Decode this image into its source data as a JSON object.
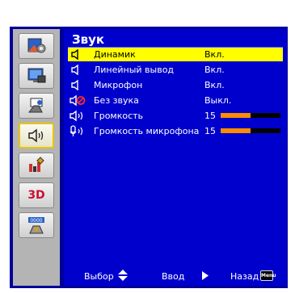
{
  "title": "Звук",
  "sidebar": {
    "items": [
      {
        "icon": "image-settings-icon",
        "active": false
      },
      {
        "icon": "display-settings-icon",
        "active": false
      },
      {
        "icon": "setup-settings-icon",
        "active": false
      },
      {
        "icon": "sound-settings-icon",
        "active": true
      },
      {
        "icon": "options-settings-icon",
        "active": false
      },
      {
        "icon": "3d-settings-icon",
        "label": "3D",
        "active": false
      },
      {
        "icon": "network-settings-icon",
        "label": "0000",
        "active": false
      }
    ]
  },
  "rows": [
    {
      "label": "Динамик",
      "value": "Вкл.",
      "icon": "speaker-icon",
      "selected": true
    },
    {
      "label": "Линейный вывод",
      "value": "Вкл.",
      "icon": "speaker-icon",
      "selected": false
    },
    {
      "label": "Микрофон",
      "value": "Вкл.",
      "icon": "speaker-icon",
      "selected": false
    },
    {
      "label": "Без звука",
      "value": "Выкл.",
      "icon": "mute-icon",
      "selected": false
    },
    {
      "label": "Громкость",
      "value": "15",
      "icon": "volume-icon",
      "level": 0.5,
      "selected": false
    },
    {
      "label": "Громкость микрофона",
      "value": "15",
      "icon": "microphone-icon",
      "level": 0.5,
      "selected": false
    }
  ],
  "footer": {
    "select_label": "Выбор",
    "enter_label": "Ввод",
    "back_label": "Назад",
    "menu_key": "Menu"
  },
  "colors": {
    "panel": "#0000cc",
    "frame": "#00009a",
    "selected_row": "#ffff00",
    "bar_fill": "#ff8c00",
    "bar_track": "#000000"
  }
}
